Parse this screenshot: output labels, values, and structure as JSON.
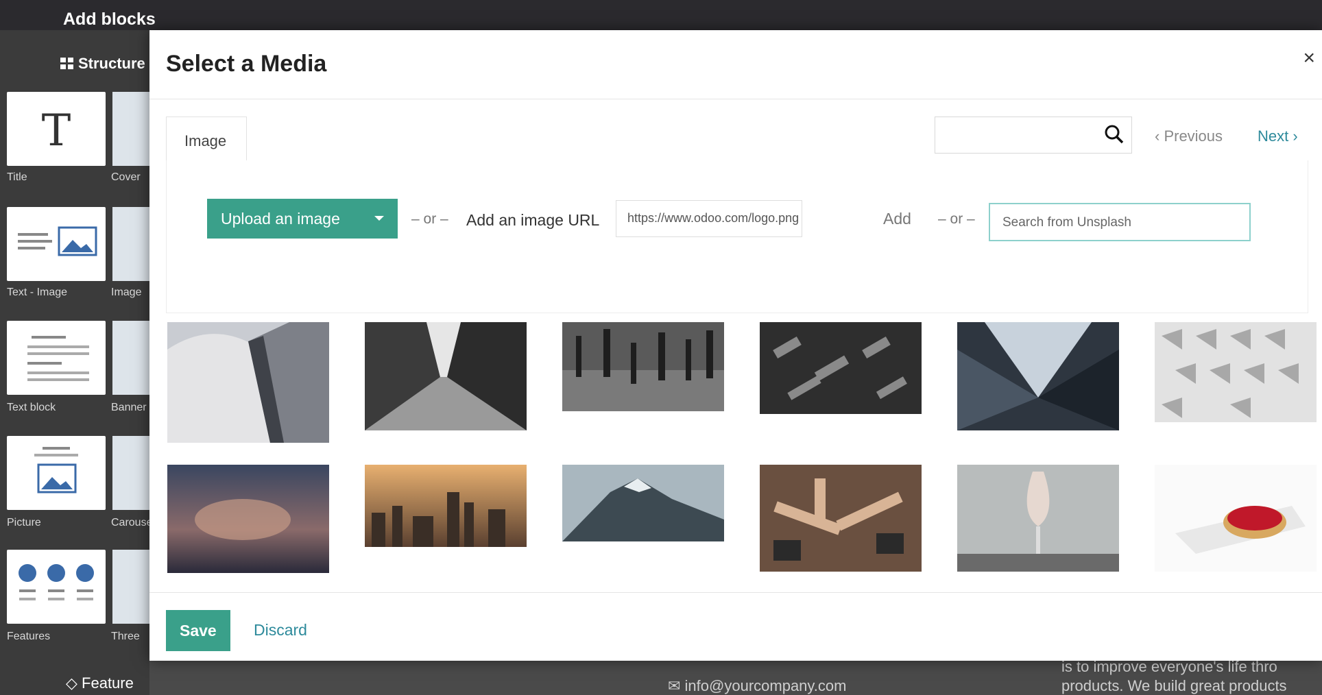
{
  "topbar": {
    "title": "Add blocks"
  },
  "sidebar": {
    "section": "Structure",
    "blocks": [
      {
        "label": "Title"
      },
      {
        "label": "Cover"
      },
      {
        "label": "Text - Image"
      },
      {
        "label": "Image"
      },
      {
        "label": "Text block"
      },
      {
        "label": "Banner"
      },
      {
        "label": "Picture"
      },
      {
        "label": "Carousel"
      },
      {
        "label": "Features"
      },
      {
        "label": "Three"
      }
    ],
    "feature_section": "Feature"
  },
  "background_page": {
    "email": "info@yourcompany.com",
    "text_line1": "is to improve everyone's life thro",
    "text_line2": "products. We build great products"
  },
  "modal": {
    "title": "Select a Media",
    "close": "×",
    "tab_label": "Image",
    "search_value": "",
    "prev_label": "‹ Previous",
    "next_label": "Next ›",
    "upload_label": "Upload an image",
    "or_label": "– or –",
    "url_label": "Add an image URL",
    "url_value": "https://www.odoo.com/logo.png",
    "add_label": "Add",
    "unsplash_placeholder": "Search from Unsplash",
    "save_label": "Save",
    "discard_label": "Discard"
  },
  "colors": {
    "accent": "#3aa08a",
    "link": "#2d8a9b",
    "topbar": "#2b2a2e"
  },
  "images": [
    {
      "name": "building-curve"
    },
    {
      "name": "skyscrapers"
    },
    {
      "name": "crowd-crossing"
    },
    {
      "name": "aerial-rooftops"
    },
    {
      "name": "glass-pyramid"
    },
    {
      "name": "white-facade"
    },
    {
      "name": "sunset-clouds"
    },
    {
      "name": "city-skyline"
    },
    {
      "name": "mountain"
    },
    {
      "name": "team-hands"
    },
    {
      "name": "wine-glass"
    },
    {
      "name": "raspberry-tart"
    }
  ]
}
